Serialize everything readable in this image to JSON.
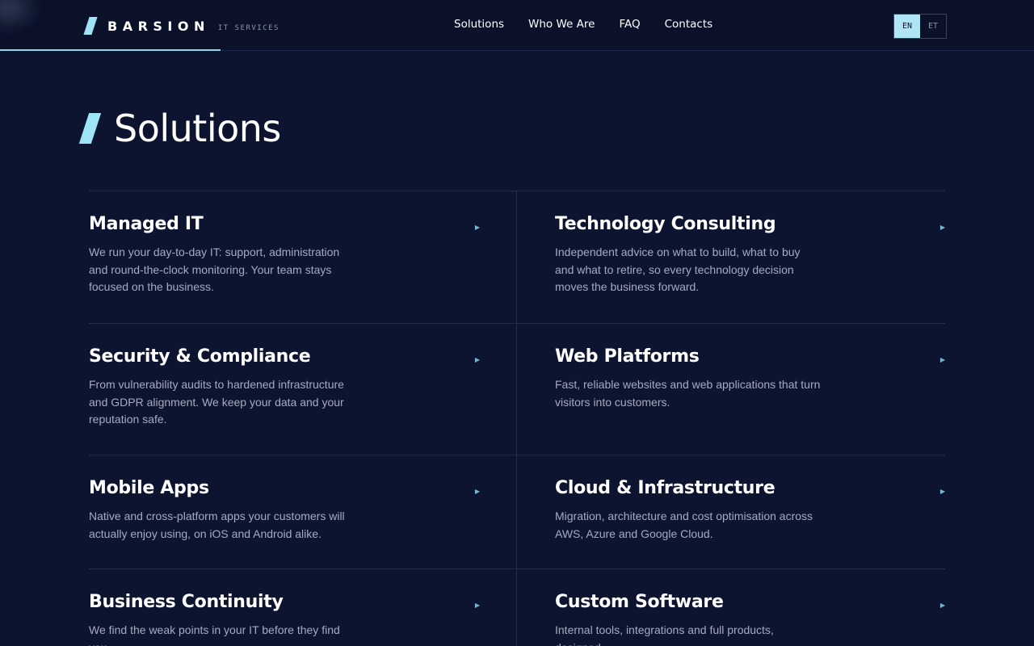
{
  "brand": {
    "name": "BARSION",
    "tagline": "IT SERVICES"
  },
  "nav": {
    "items": [
      "Solutions",
      "Who We Are",
      "FAQ",
      "Contacts"
    ]
  },
  "lang": {
    "options": [
      "EN",
      "ET"
    ],
    "active": "EN"
  },
  "page": {
    "title": "Solutions"
  },
  "solutions": [
    {
      "title": "Managed IT",
      "desc": "We run your day-to-day IT: support, administration and round-the-clock monitoring. Your team stays focused on the business."
    },
    {
      "title": "Technology Consulting",
      "desc": "Independent advice on what to build, what to buy and what to retire, so every technology decision moves the business forward."
    },
    {
      "title": "Security & Compliance",
      "desc": "From vulnerability audits to hardened infrastructure and GDPR alignment. We keep your data and your reputation safe."
    },
    {
      "title": "Web Platforms",
      "desc": "Fast, reliable websites and web applications that turn visitors into customers."
    },
    {
      "title": "Mobile Apps",
      "desc": "Native and cross-platform apps your customers will actually enjoy using, on iOS and Android alike."
    },
    {
      "title": "Cloud & Infrastructure",
      "desc": "Migration, architecture and cost optimisation across AWS, Azure and Google Cloud."
    },
    {
      "title": "Business Continuity",
      "desc": "We find the weak points in your IT before they find you,"
    },
    {
      "title": "Custom Software",
      "desc": "Internal tools, integrations and full products, designed"
    }
  ],
  "icons": {
    "arrow": "triangle-right-icon",
    "logo_mark": "slash-mark-icon"
  },
  "colors": {
    "background": "#0d1430",
    "accent": "#9fe3f6",
    "text_muted": "#a4abc0"
  }
}
